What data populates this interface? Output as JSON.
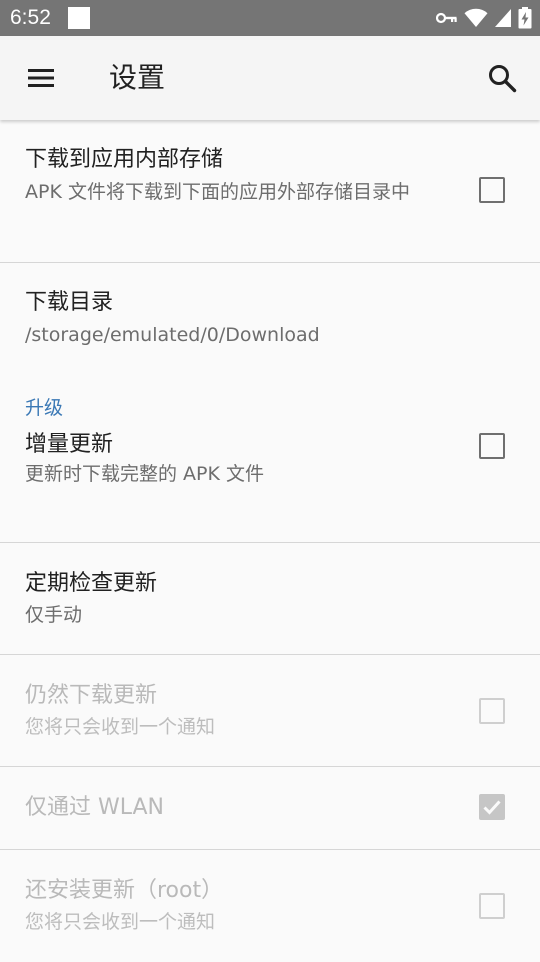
{
  "status_bar": {
    "time": "6:52"
  },
  "app_bar": {
    "title": "设置",
    "menu_icon": "hamburger-menu-icon",
    "search_icon": "search-icon"
  },
  "prefs": {
    "internal_storage": {
      "title": "下载到应用内部存储",
      "summary": "APK 文件将下载到下面的应用外部存储目录中",
      "checked": false
    },
    "download_dir": {
      "title": "下载目录",
      "summary": "/storage/emulated/0/Download"
    },
    "category_upgrade": "升级",
    "incremental_update": {
      "title": "增量更新",
      "summary": "更新时下载完整的 APK 文件",
      "checked": false
    },
    "periodic_check": {
      "title": "定期检查更新",
      "summary": "仅手动"
    },
    "still_download": {
      "title": "仍然下载更新",
      "summary": "您将只会收到一个通知",
      "checked": false,
      "enabled": false
    },
    "wlan_only": {
      "title": "仅通过 WLAN",
      "checked": true,
      "enabled": false
    },
    "install_root": {
      "title": "还安装更新（root）",
      "summary": "您将只会收到一个通知",
      "checked": false,
      "enabled": false
    }
  },
  "colors": {
    "status_bar": "#757575",
    "accent": "#3a78b5",
    "background": "#fafafa"
  }
}
